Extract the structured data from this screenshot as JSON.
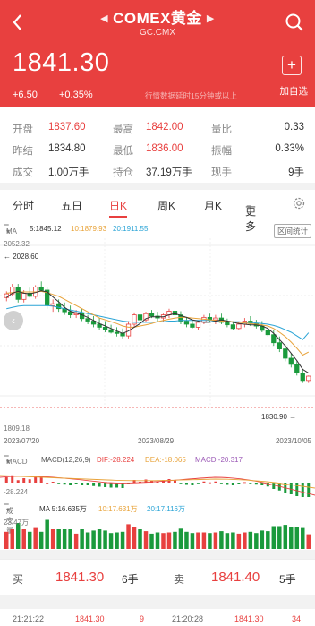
{
  "header": {
    "back_icon": "chevron-left-icon",
    "title": "COMEX黄金",
    "code": "GC.CMX",
    "search_icon": "search-icon",
    "price": "1841.30",
    "change": "+6.50",
    "change_pct": "+0.35%",
    "note": "行情数据延时15分钟或以上",
    "add_label": "加自选",
    "add_icon": "plus-icon",
    "bg_color": "#e8403f"
  },
  "stats": {
    "open_label": "开盘",
    "open": "1837.60",
    "high_label": "最高",
    "high": "1842.00",
    "ratio_label": "量比",
    "ratio": "0.33",
    "prev_close_label": "昨结",
    "prev_close": "1834.80",
    "low_label": "最低",
    "low": "1836.00",
    "amplitude_label": "振幅",
    "amplitude": "0.33%",
    "volume_label": "成交",
    "volume": "1.00万手",
    "position_label": "持仓",
    "position": "37.19万手",
    "current_label": "现手",
    "current": "9手"
  },
  "tabs": {
    "items": [
      "分时",
      "五日",
      "日K",
      "周K",
      "月K",
      "更多"
    ],
    "active": "日K",
    "settings_icon": "gear-icon"
  },
  "ma_legend": {
    "badge": "MA",
    "ma5": "5:1845.12",
    "ma10": "10:1879.93",
    "ma20": "20:1911.55",
    "interval_btn": "区间统计",
    "colors": {
      "ma5": "#333333",
      "ma10": "#e8a33a",
      "ma20": "#2aa4d6"
    }
  },
  "price_axis": {
    "top": "2052.32",
    "high_marker": "2028.60",
    "bottom": "1809.18",
    "low_marker": "1830.90"
  },
  "dates": [
    "2023/07/20",
    "2023/08/29",
    "2023/10/05"
  ],
  "macd_legend": {
    "badge": "MACD",
    "params": "MACD(12,26,9)",
    "dif": "DIF:-28.224",
    "dea": "DEA:-18.065",
    "macd": "MACD:-20.317",
    "axis_low": "-28.224"
  },
  "vol_legend": {
    "badge": "成交量",
    "ma5": "MA 5:16.635万",
    "ma10": "10:17.631万",
    "ma20": "20:17.116万",
    "axis_top": "23.47万"
  },
  "chart_data": {
    "type": "candlestick",
    "x_start": "2023/07/20",
    "x_end": "2023/10/05",
    "ylim": [
      1809.18,
      2052.32
    ],
    "ohlc": [
      [
        1968,
        1978,
        1962,
        1974
      ],
      [
        1974,
        1990,
        1970,
        1985
      ],
      [
        1985,
        1990,
        1960,
        1965
      ],
      [
        1965,
        1980,
        1960,
        1975
      ],
      [
        1975,
        1984,
        1968,
        1970
      ],
      [
        1970,
        1988,
        1966,
        1985
      ],
      [
        1985,
        1994,
        1978,
        1980
      ],
      [
        1980,
        1985,
        1950,
        1955
      ],
      [
        1955,
        1965,
        1945,
        1958
      ],
      [
        1958,
        1965,
        1945,
        1950
      ],
      [
        1950,
        1960,
        1940,
        1945
      ],
      [
        1945,
        1955,
        1935,
        1940
      ],
      [
        1940,
        1948,
        1935,
        1942
      ],
      [
        1942,
        1950,
        1930,
        1934
      ],
      [
        1934,
        1940,
        1925,
        1930
      ],
      [
        1930,
        1938,
        1920,
        1925
      ],
      [
        1925,
        1935,
        1915,
        1920
      ],
      [
        1920,
        1930,
        1912,
        1916
      ],
      [
        1916,
        1924,
        1910,
        1912
      ],
      [
        1912,
        1920,
        1905,
        1910
      ],
      [
        1910,
        1918,
        1902,
        1906
      ],
      [
        1906,
        1930,
        1902,
        1925
      ],
      [
        1925,
        1944,
        1920,
        1940
      ],
      [
        1940,
        1948,
        1928,
        1932
      ],
      [
        1932,
        1945,
        1928,
        1942
      ],
      [
        1942,
        1948,
        1935,
        1938
      ],
      [
        1938,
        1945,
        1930,
        1935
      ],
      [
        1935,
        1942,
        1928,
        1940
      ],
      [
        1940,
        1950,
        1935,
        1946
      ],
      [
        1946,
        1952,
        1936,
        1940
      ],
      [
        1940,
        1946,
        1925,
        1930
      ],
      [
        1930,
        1936,
        1920,
        1925
      ],
      [
        1925,
        1932,
        1918,
        1920
      ],
      [
        1920,
        1930,
        1915,
        1928
      ],
      [
        1928,
        1940,
        1925,
        1936
      ],
      [
        1936,
        1942,
        1928,
        1932
      ],
      [
        1932,
        1940,
        1925,
        1935
      ],
      [
        1935,
        1942,
        1925,
        1928
      ],
      [
        1928,
        1934,
        1920,
        1924
      ],
      [
        1924,
        1930,
        1915,
        1918
      ],
      [
        1918,
        1928,
        1915,
        1925
      ],
      [
        1925,
        1935,
        1920,
        1930
      ],
      [
        1930,
        1938,
        1922,
        1926
      ],
      [
        1926,
        1932,
        1918,
        1922
      ],
      [
        1922,
        1930,
        1912,
        1915
      ],
      [
        1915,
        1922,
        1905,
        1908
      ],
      [
        1908,
        1915,
        1890,
        1895
      ],
      [
        1895,
        1905,
        1880,
        1885
      ],
      [
        1885,
        1892,
        1865,
        1870
      ],
      [
        1870,
        1878,
        1855,
        1860
      ],
      [
        1860,
        1866,
        1842,
        1846
      ],
      [
        1846,
        1852,
        1830,
        1834
      ],
      [
        1834,
        1842,
        1830,
        1841
      ]
    ],
    "ma5": [
      1968,
      1975,
      1978,
      1975,
      1974,
      1976,
      1979,
      1977,
      1969,
      1961,
      1952,
      1946,
      1943,
      1940,
      1936,
      1931,
      1926,
      1922,
      1918,
      1914,
      1910,
      1914,
      1920,
      1926,
      1934,
      1937,
      1937,
      1937,
      1940,
      1942,
      1939,
      1936,
      1932,
      1930,
      1928,
      1928,
      1930,
      1932,
      1930,
      1928,
      1926,
      1925,
      1924,
      1924,
      1922,
      1918,
      1910,
      1900,
      1890,
      1878,
      1866,
      1852,
      1846
    ],
    "ma10": [
      1975,
      1976,
      1977,
      1977,
      1977,
      1977,
      1978,
      1976,
      1973,
      1970,
      1965,
      1960,
      1955,
      1950,
      1945,
      1940,
      1935,
      1932,
      1929,
      1926,
      1922,
      1920,
      1920,
      1922,
      1924,
      1926,
      1929,
      1931,
      1933,
      1935,
      1936,
      1936,
      1935,
      1934,
      1933,
      1932,
      1931,
      1930,
      1930,
      1929,
      1928,
      1927,
      1926,
      1925,
      1924,
      1922,
      1918,
      1912,
      1905,
      1896,
      1886,
      1875,
      1880
    ],
    "ma20": [
      1950,
      1952,
      1954,
      1955,
      1955,
      1955,
      1955,
      1955,
      1954,
      1952,
      1950,
      1948,
      1946,
      1944,
      1942,
      1940,
      1938,
      1936,
      1934,
      1932,
      1930,
      1929,
      1928,
      1928,
      1928,
      1928,
      1929,
      1929,
      1930,
      1930,
      1931,
      1931,
      1931,
      1931,
      1931,
      1931,
      1930,
      1930,
      1930,
      1929,
      1929,
      1928,
      1928,
      1927,
      1926,
      1925,
      1923,
      1920,
      1916,
      1912,
      1906,
      1900,
      1911
    ]
  },
  "bid_ask": {
    "buy_label": "买一",
    "buy_price": "1841.30",
    "buy_qty": "6手",
    "sell_label": "卖一",
    "sell_price": "1841.40",
    "sell_qty": "5手"
  },
  "trades": {
    "t1": "21:21:22",
    "p1": "1841.30",
    "q1": "9",
    "t2": "21:20:28",
    "p2": "1841.30",
    "q2": "34"
  }
}
